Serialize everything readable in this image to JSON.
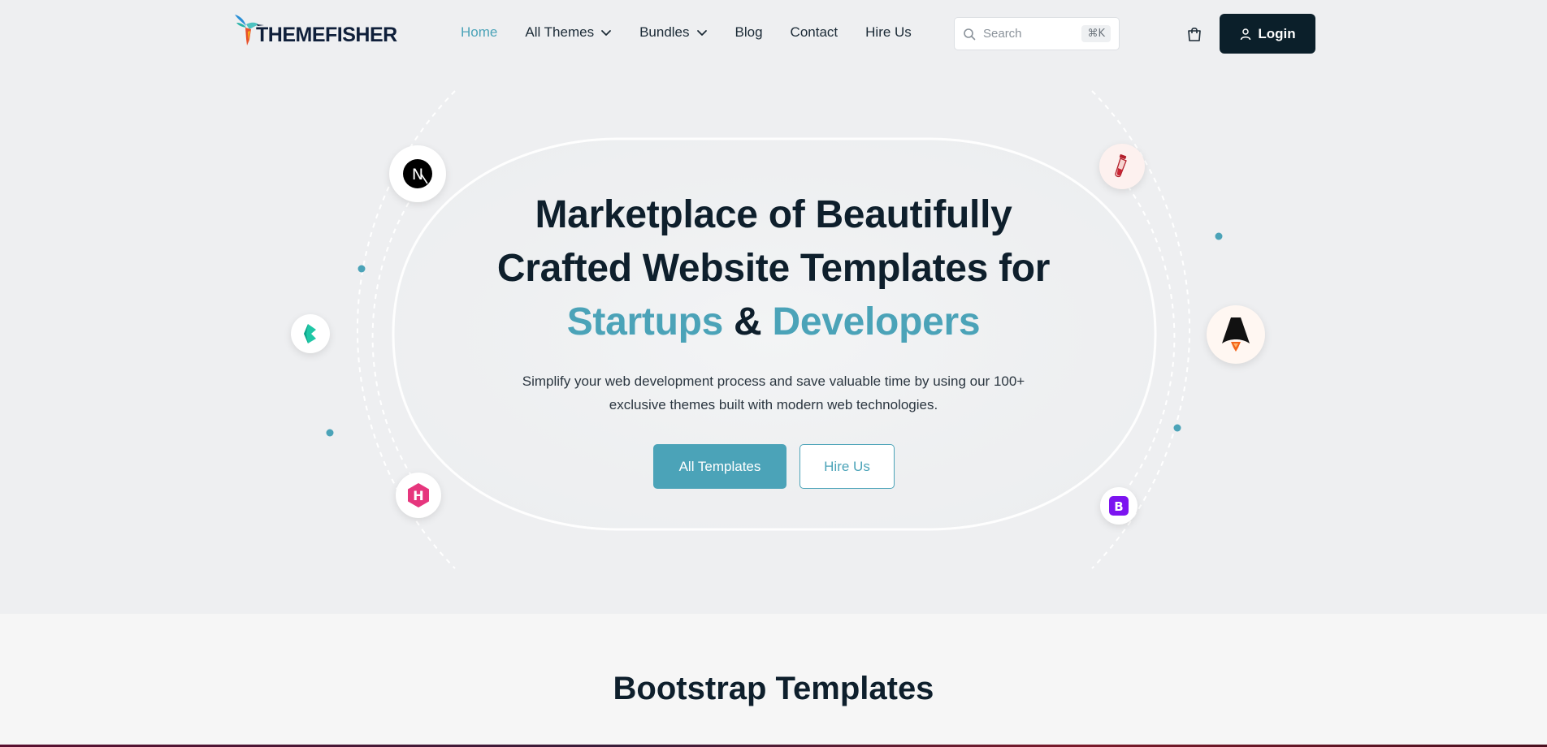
{
  "header": {
    "logo_text": "THEMEFISHER",
    "nav": [
      {
        "label": "Home",
        "active": true,
        "dropdown": false
      },
      {
        "label": "All Themes",
        "active": false,
        "dropdown": true
      },
      {
        "label": "Bundles",
        "active": false,
        "dropdown": true
      },
      {
        "label": "Blog",
        "active": false,
        "dropdown": false
      },
      {
        "label": "Contact",
        "active": false,
        "dropdown": false
      },
      {
        "label": "Hire Us",
        "active": false,
        "dropdown": false
      }
    ],
    "search_placeholder": "Search",
    "search_shortcut": "⌘K",
    "login_label": "Login"
  },
  "hero": {
    "title_line1": "Marketplace of Beautifully",
    "title_line2": "Crafted Website Templates for",
    "title_accent1": "Startups",
    "title_amp": "&",
    "title_accent2": "Developers",
    "subtitle_line1": "Simplify your web development process and save valuable time by using our 100+",
    "subtitle_line2": "exclusive themes built with modern web technologies.",
    "primary_button": "All Templates",
    "secondary_button": "Hire Us",
    "tech_icons": [
      "nextjs-icon",
      "butter-icon",
      "hugo-icon",
      "test-tube-icon",
      "astro-icon",
      "bootstrap-icon"
    ],
    "bootstrap_letter": "B",
    "hugo_letter": "H",
    "next_letter": "N"
  },
  "section": {
    "title": "Bootstrap Templates"
  },
  "colors": {
    "accent": "#4ba3b8",
    "dark": "#0b1f2a",
    "hero_bg": "#eeeff1"
  }
}
